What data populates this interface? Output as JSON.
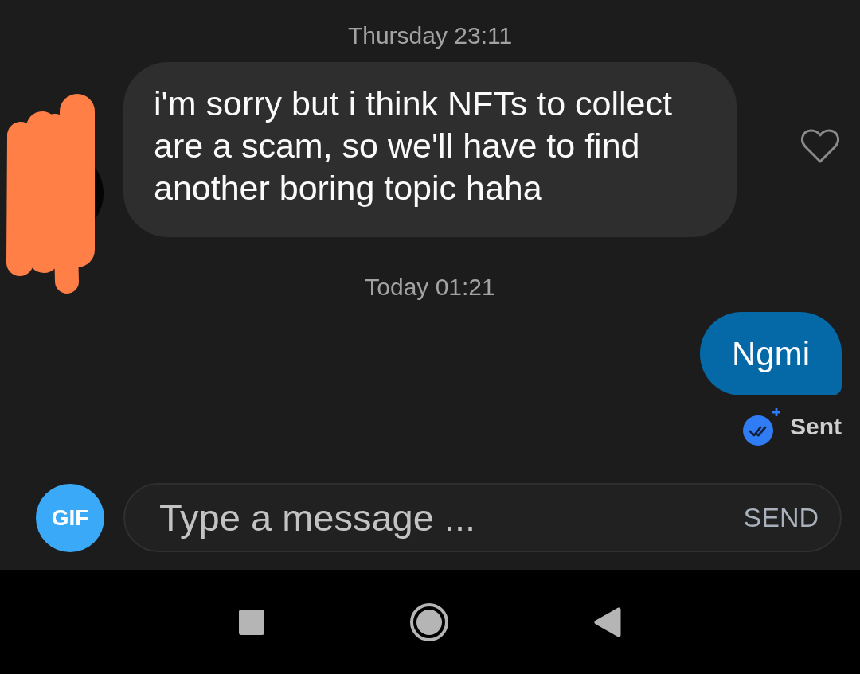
{
  "conversation": [
    {
      "kind": "timestamp",
      "text": "Thursday 23:11"
    },
    {
      "kind": "received",
      "text": "i'm sorry but i think NFTs to collect are a scam, so we'll have to find another boring topic haha",
      "liked": false
    },
    {
      "kind": "timestamp",
      "text": "Today 01:21"
    },
    {
      "kind": "sent",
      "text": "Ngmi",
      "status": "Sent"
    }
  ],
  "composer": {
    "gif_button": "GIF",
    "placeholder": "Type a message ...",
    "send_button": "SEND"
  }
}
